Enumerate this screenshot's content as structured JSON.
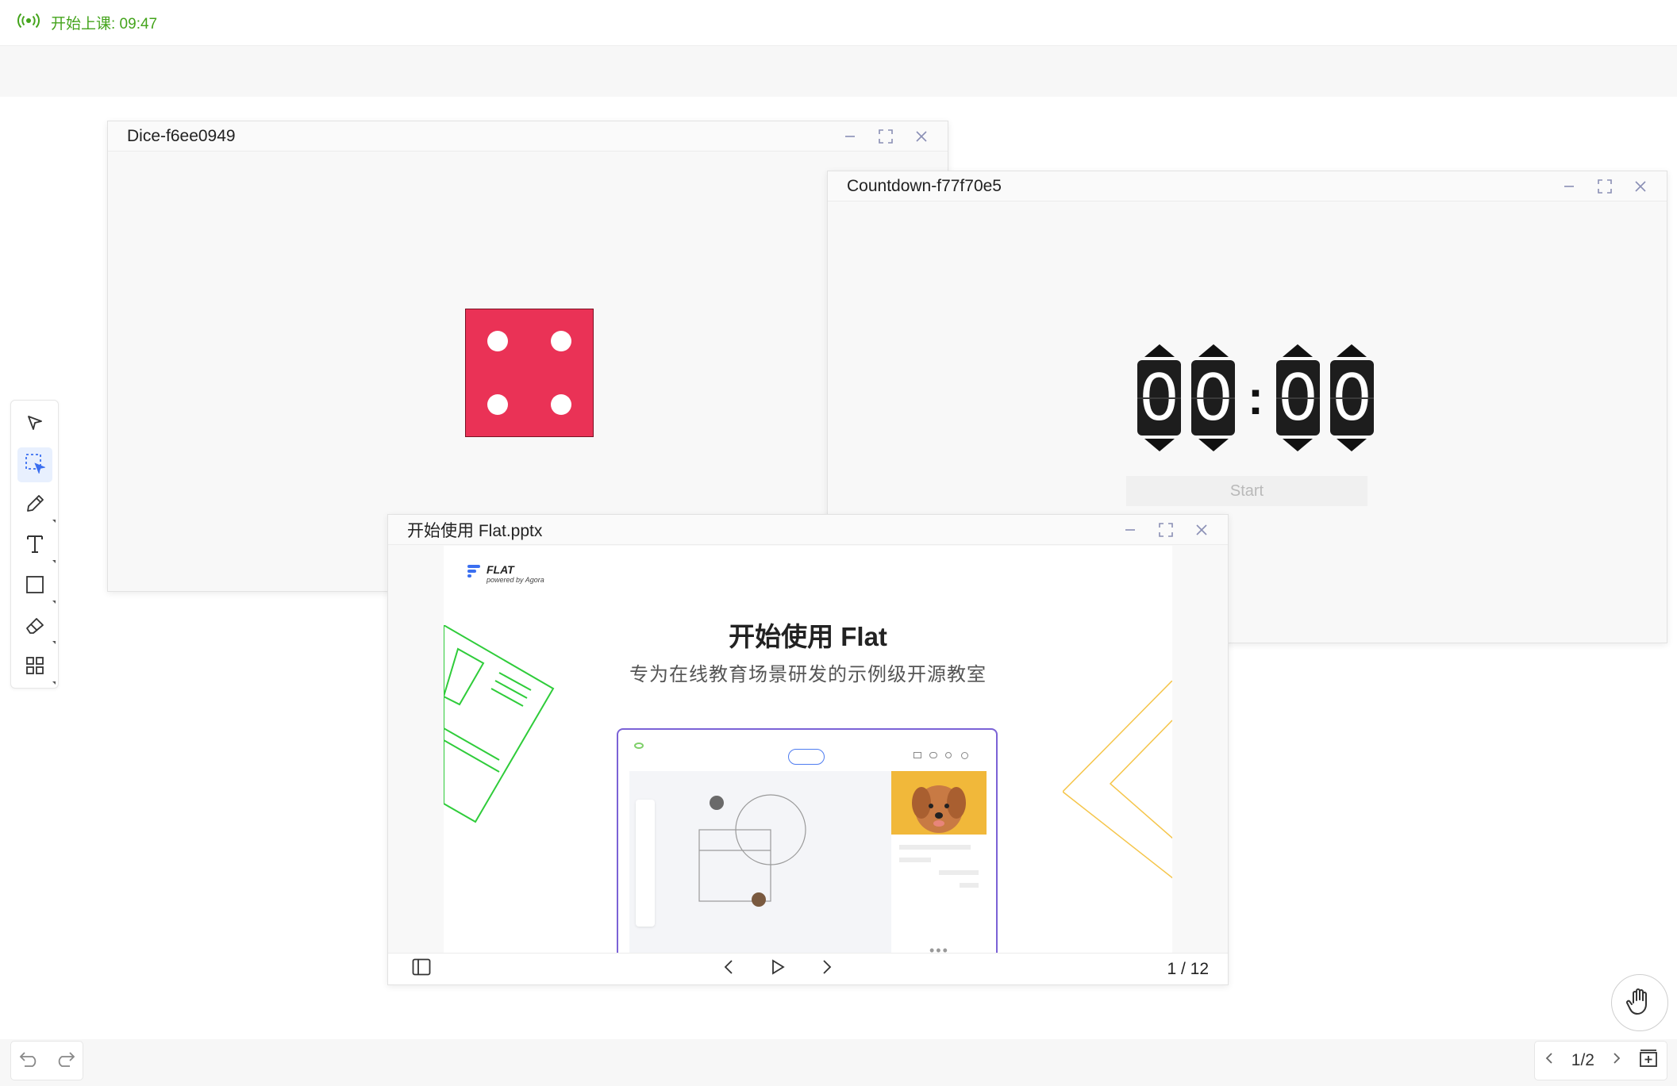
{
  "status": {
    "label": "开始上课: 09:47",
    "color": "#44a41c"
  },
  "windows": {
    "dice": {
      "title": "Dice-f6ee0949",
      "face_value": 4,
      "face_color": "#ea3256"
    },
    "countdown": {
      "title": "Countdown-f77f70e5",
      "digits": [
        "0",
        "0",
        "0",
        "0"
      ],
      "separator": ":",
      "start_label": "Start"
    },
    "slides": {
      "title": "开始使用 Flat.pptx",
      "brand": "FLAT",
      "brand_sub": "powered by Agora",
      "heading": "开始使用 Flat",
      "subheading": "专为在线教育场景研发的示例级开源教室",
      "page_current": "1",
      "page_total": "/ 12"
    }
  },
  "pager": {
    "label": "1/2"
  },
  "icons": {
    "status": "broadcast-icon",
    "tools": [
      "pointer-icon",
      "selector-icon",
      "pencil-icon",
      "text-icon",
      "rectangle-icon",
      "eraser-icon",
      "apps-grid-icon"
    ],
    "window_controls": [
      "minimize-icon",
      "maximize-icon",
      "close-icon"
    ],
    "hand": "raise-hand-icon"
  }
}
